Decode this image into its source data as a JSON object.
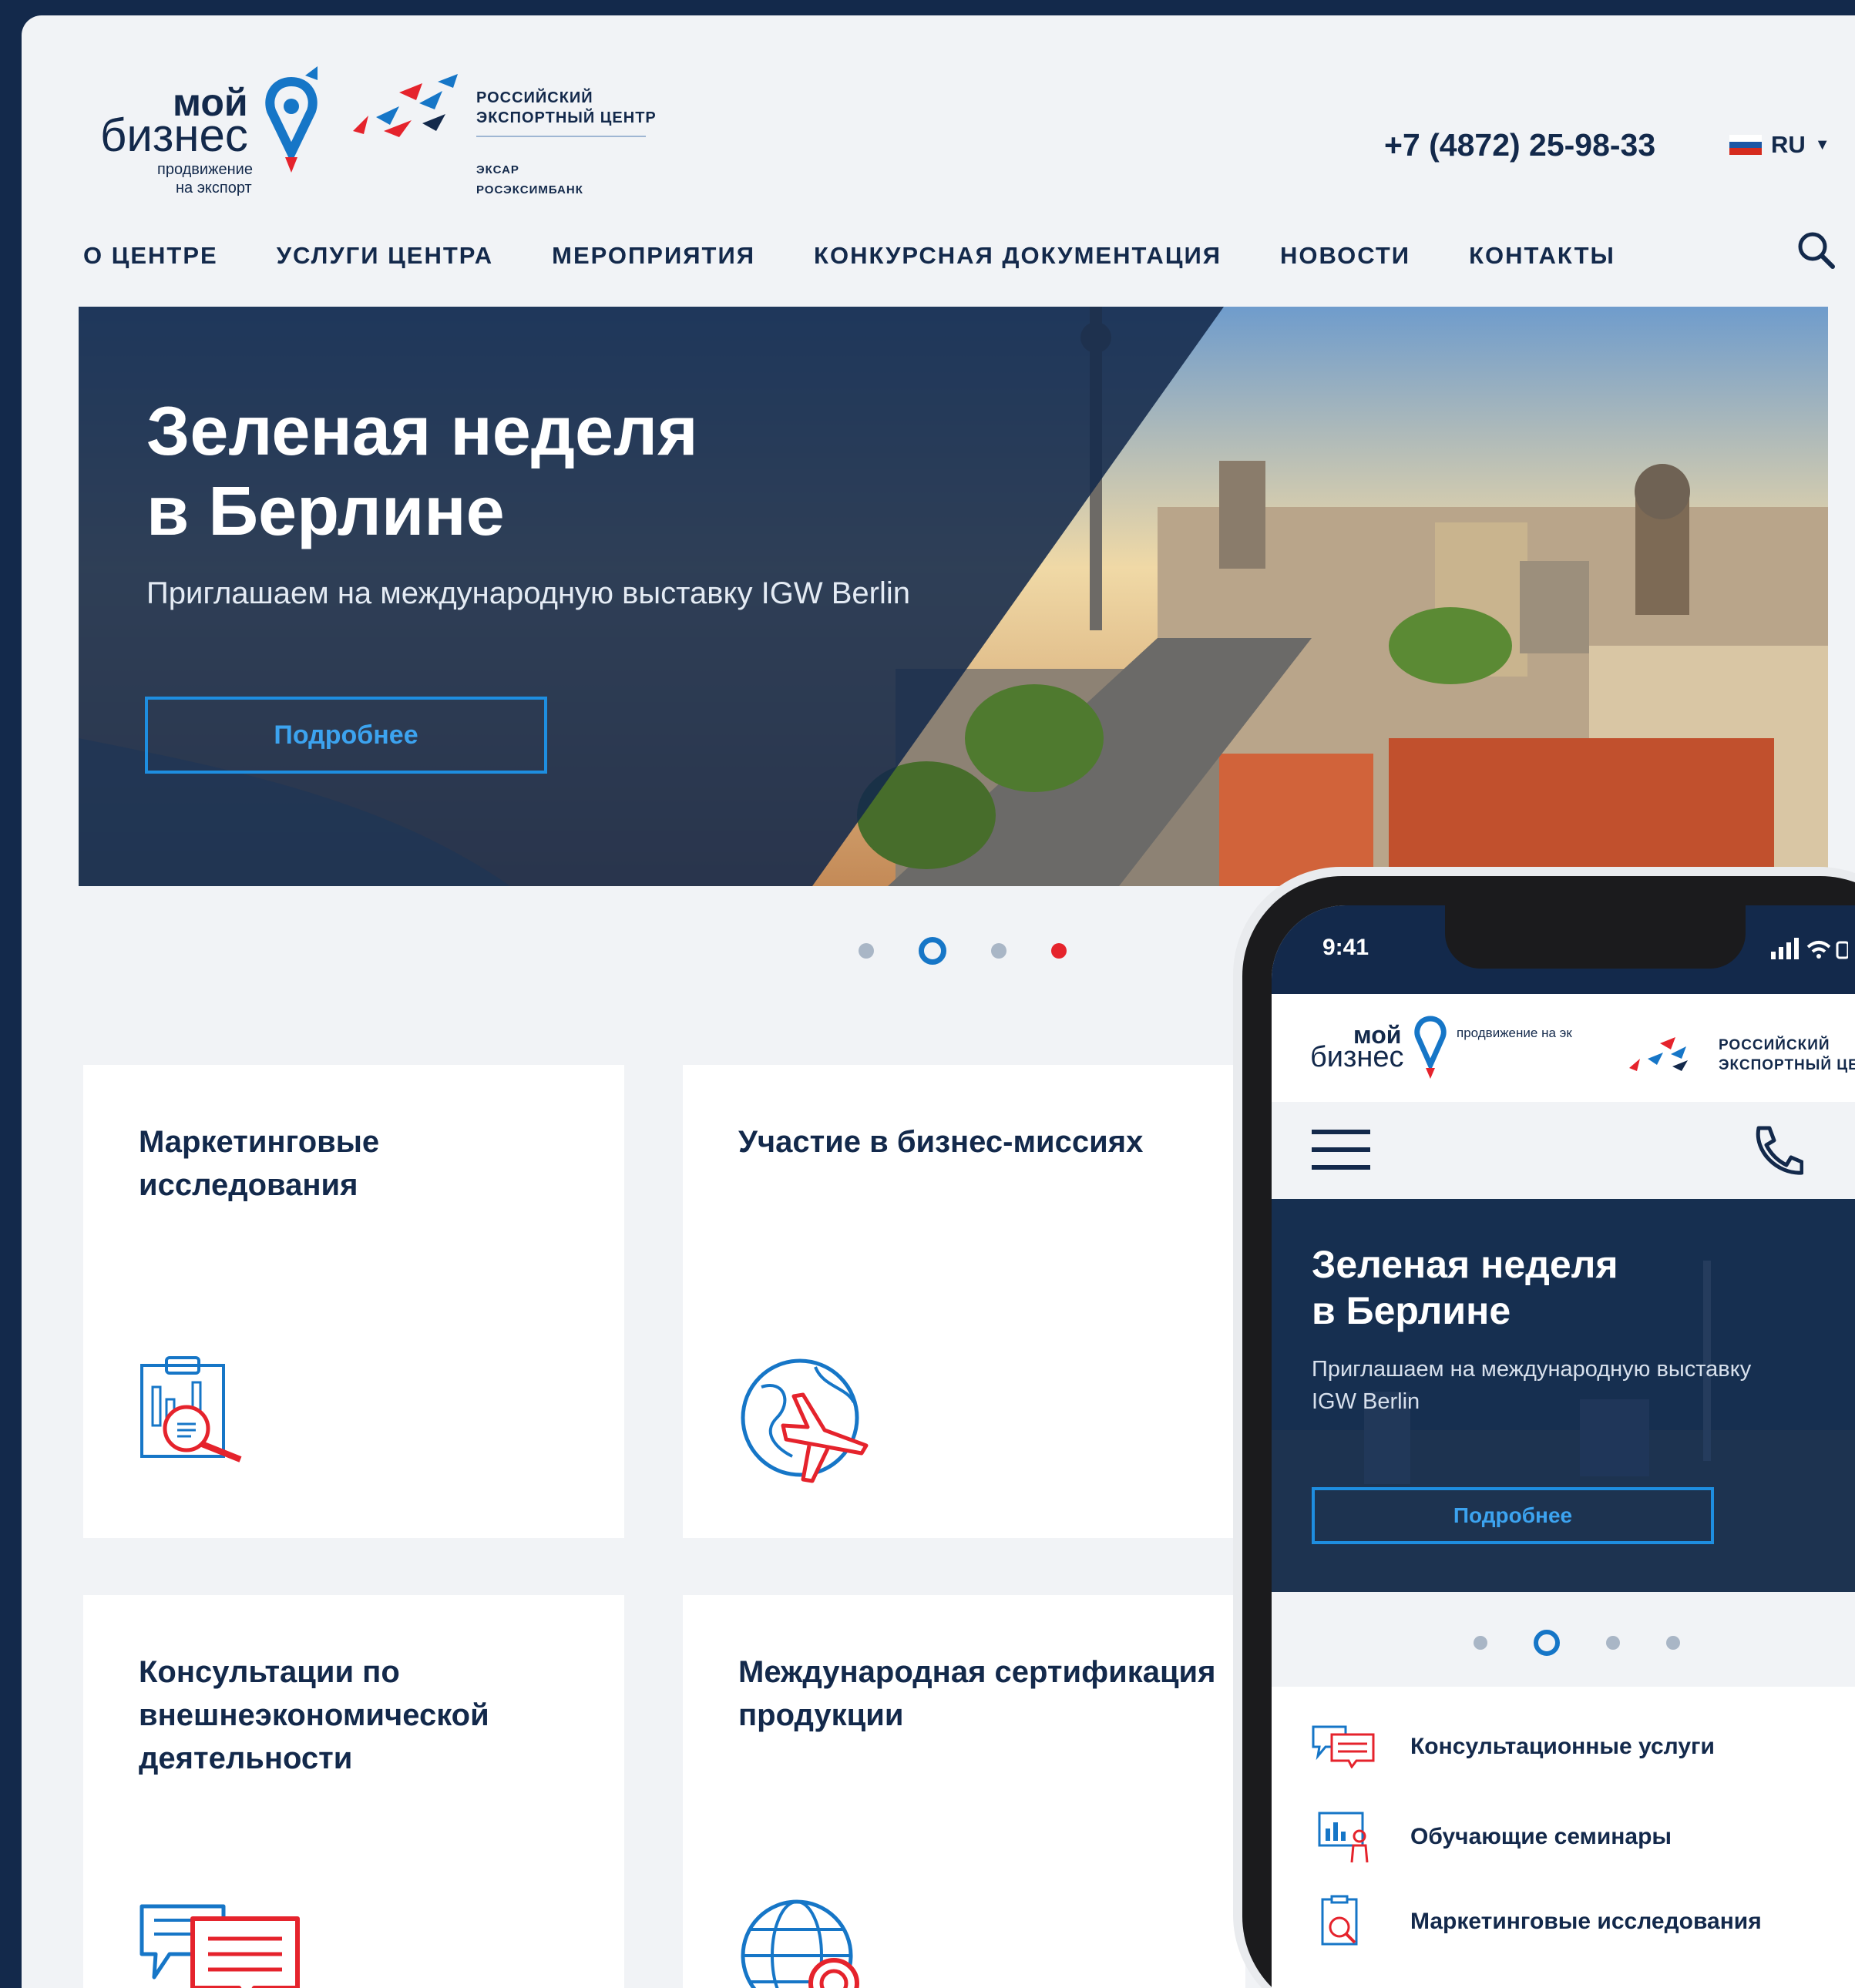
{
  "header": {
    "logo_moy_top": "мой",
    "logo_moy_main": "бизнес",
    "logo_moy_tag1": "продвижение",
    "logo_moy_tag2": "на экспорт",
    "logo_rec_line1": "РОССИЙСКИЙ",
    "logo_rec_line2": "ЭКСПОРТНЫЙ ЦЕНТР",
    "logo_exiar": "ЭКСАР",
    "logo_eximbank": "РОСЭКСИМБАНК",
    "phone": "+7 (4872) 25-98-33",
    "language": "RU"
  },
  "nav": {
    "items": [
      "О ЦЕНТРЕ",
      "УСЛУГИ ЦЕНТРА",
      "МЕРОПРИЯТИЯ",
      "КОНКУРСНАЯ ДОКУМЕНТАЦИЯ",
      "НОВОСТИ",
      "КОНТАКТЫ"
    ]
  },
  "hero": {
    "title_line1": "Зеленая неделя",
    "title_line2": "в Берлине",
    "subtitle": "Приглашаем на международную выставку IGW Berlin",
    "button": "Подробнее"
  },
  "slider": {
    "count": 4,
    "active": 2
  },
  "cards": [
    {
      "title": "Маркетинговые исследования",
      "icon": "clipboard-magnifier-icon"
    },
    {
      "title": "Участие в бизнес-миссиях",
      "icon": "globe-airplane-icon"
    },
    {
      "title": "Консультации по внешнеэкономической деятельности",
      "icon": "chat-bubbles-icon"
    },
    {
      "title": "Международная сертификация продукции",
      "icon": "globe-certificate-icon"
    }
  ],
  "mobile": {
    "time": "9:41",
    "logo_moy_top": "мой",
    "logo_moy_main": "бизнес",
    "logo_tag": "продвижение на экспорт",
    "logo_rec_line1": "РОССИЙСКИЙ",
    "logo_rec_line2": "ЭКСПОРТНЫЙ ЦЕНТР",
    "hero_title_line1": "Зеленая неделя",
    "hero_title_line2": "в Берлине",
    "hero_subtitle": "Приглашаем на международную выставку IGW Berlin",
    "hero_button": "Подробнее",
    "services": [
      {
        "label": "Консультационные услуги",
        "icon": "chat-icon"
      },
      {
        "label": "Обучающие семинары",
        "icon": "seminar-board-icon"
      },
      {
        "label": "Маркетинговые исследования",
        "icon": "clipboard-magnifier-icon"
      }
    ]
  },
  "colors": {
    "navy": "#13294b",
    "accent_blue": "#1e8ee0",
    "accent_red": "#e5232c",
    "background": "#f1f3f6"
  }
}
